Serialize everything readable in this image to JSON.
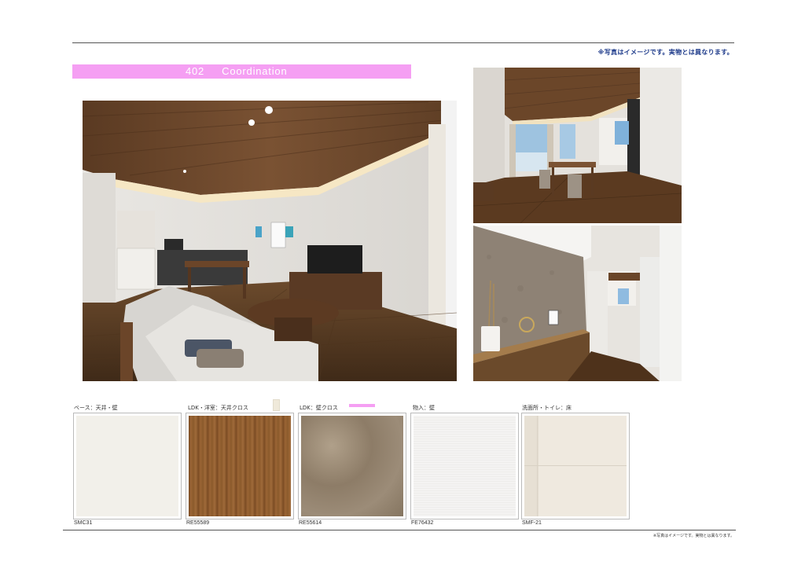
{
  "header": {
    "note": "※写真はイメージです。実物とは異なります。",
    "title_number": "402",
    "title_word": "Coordination",
    "accent_color": "#f59ff3"
  },
  "footer": {
    "note": "※写真はイメージです。実物とは異なります。"
  },
  "swatches": [
    {
      "label": "ベース：天井・壁",
      "code": "SMC31",
      "color": "#f2f0ea"
    },
    {
      "label": "LDK・洋室：天井クロス",
      "code": "RE55589",
      "color": "#8b5a2b"
    },
    {
      "label": "LDK：壁クロス",
      "code": "RE55614",
      "color": "#9c8c78"
    },
    {
      "label": "物入：壁",
      "code": "FE76432",
      "color": "#f4f3f2"
    },
    {
      "label": "洗面所・トイレ：床",
      "code": "SMF-21",
      "color": "#ede7dc"
    }
  ]
}
